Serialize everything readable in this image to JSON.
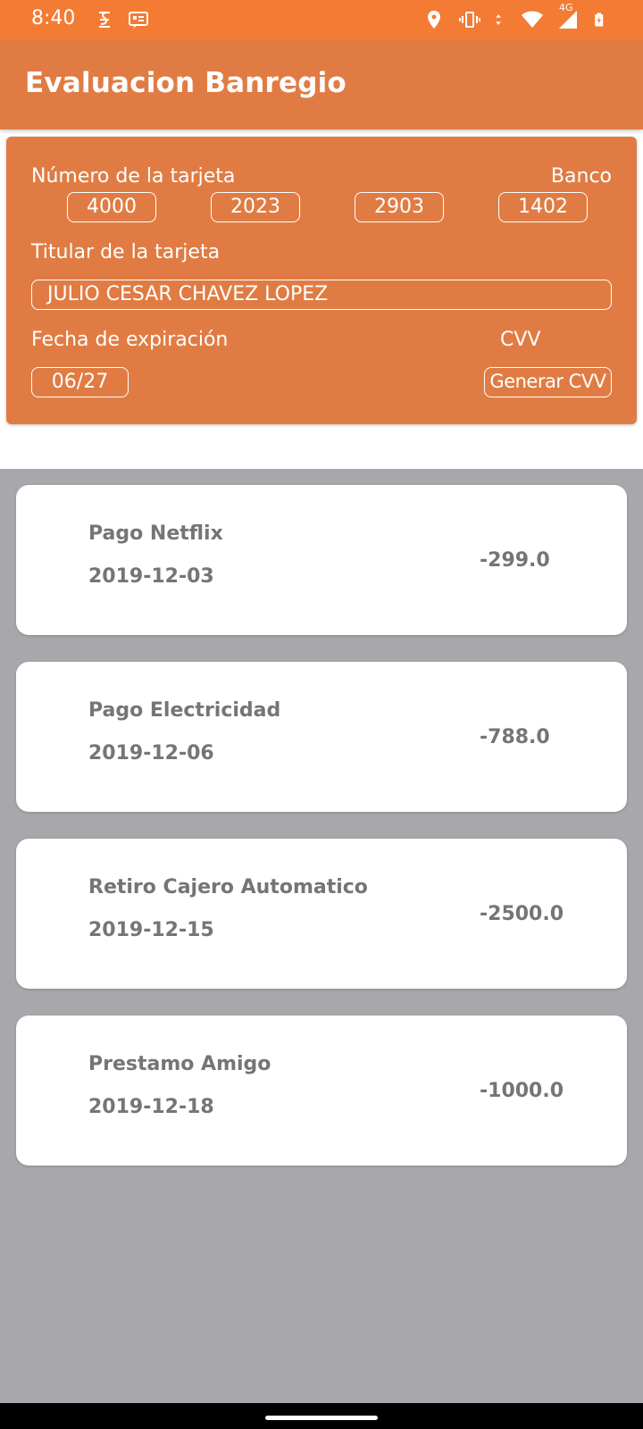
{
  "status_bar": {
    "time": "8:40",
    "network_label": "4G",
    "icons": [
      "s-notification-icon",
      "message-icon",
      "location-icon",
      "vibrate-icon",
      "data-arrows-icon",
      "wifi-icon",
      "signal-icon",
      "battery-charging-icon"
    ]
  },
  "app_bar": {
    "title": "Evaluacion Banregio"
  },
  "card": {
    "number_label": "Número de la tarjeta",
    "bank_label": "Banco",
    "number_groups": [
      "4000",
      "2023",
      "2903",
      "1402"
    ],
    "holder_label": "Titular de la tarjeta",
    "holder_value": "JULIO CESAR CHAVEZ LOPEZ",
    "expiry_label": "Fecha de expiración",
    "cvv_label": "CVV",
    "expiry_value": "06/27",
    "generate_cvv_label": "Generar CVV"
  },
  "transactions": [
    {
      "name": "Pago Netflix",
      "date": "2019-12-03",
      "amount": "-299.0"
    },
    {
      "name": "Pago Electricidad",
      "date": "2019-12-06",
      "amount": "-788.0"
    },
    {
      "name": "Retiro Cajero Automatico",
      "date": "2019-12-15",
      "amount": "-2500.0"
    },
    {
      "name": "Prestamo Amigo",
      "date": "2019-12-18",
      "amount": "-1000.0"
    }
  ],
  "colors": {
    "status_bar": "#f47b33",
    "app_bar": "#e07c43",
    "list_background": "#a8a7ab",
    "text_secondary": "#757575"
  }
}
